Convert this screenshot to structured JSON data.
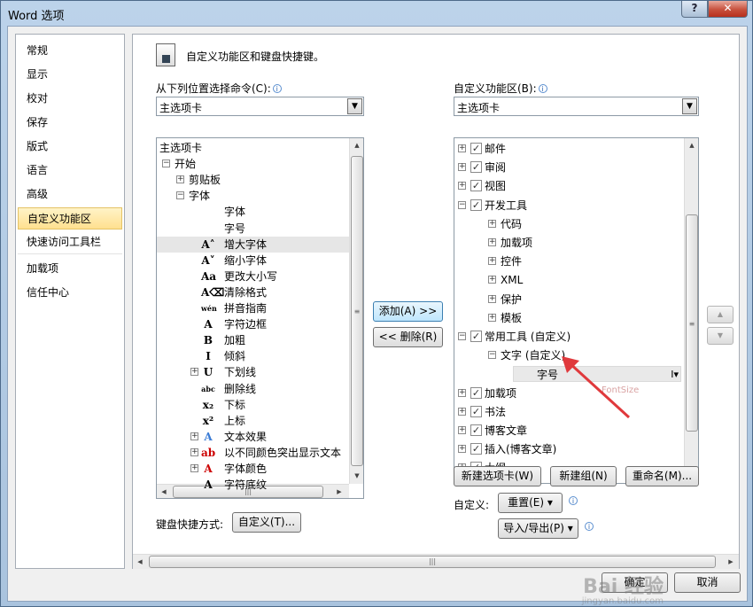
{
  "window": {
    "title": "Word 选项",
    "help_label": "?",
    "close_label": "✕"
  },
  "nav": {
    "items": [
      {
        "label": "常规"
      },
      {
        "label": "显示"
      },
      {
        "label": "校对"
      },
      {
        "label": "保存"
      },
      {
        "label": "版式"
      },
      {
        "label": "语言"
      },
      {
        "label": "高级"
      },
      {
        "label": "自定义功能区"
      },
      {
        "label": "快速访问工具栏"
      },
      {
        "label": "加载项"
      },
      {
        "label": "信任中心"
      }
    ],
    "selected": "自定义功能区"
  },
  "header": {
    "title": "自定义功能区和键盘快捷键。"
  },
  "left": {
    "label": "从下列位置选择命令(C):",
    "combo_value": "主选项卡",
    "tree": [
      {
        "label": "主选项卡"
      },
      {
        "label": "开始",
        "exp": "−"
      },
      {
        "label": "剪贴板",
        "exp": "+"
      },
      {
        "label": "字体",
        "exp": "−"
      },
      {
        "label": "字体"
      },
      {
        "label": "字号"
      },
      {
        "label": "增大字体",
        "icon": "A˄"
      },
      {
        "label": "缩小字体",
        "icon": "A˅"
      },
      {
        "label": "更改大小写",
        "icon": "Aa"
      },
      {
        "label": "清除格式",
        "icon": "A⌫"
      },
      {
        "label": "拼音指南",
        "icon": "wén"
      },
      {
        "label": "字符边框",
        "icon": "A"
      },
      {
        "label": "加粗",
        "icon": "B"
      },
      {
        "label": "倾斜",
        "icon": "I"
      },
      {
        "label": "下划线",
        "icon": "U",
        "exp": "+"
      },
      {
        "label": "删除线",
        "icon": "abc"
      },
      {
        "label": "下标",
        "icon": "x₂"
      },
      {
        "label": "上标",
        "icon": "x²"
      },
      {
        "label": "文本效果",
        "icon": "A",
        "exp": "+"
      },
      {
        "label": "以不同颜色突出显示文本",
        "icon": "ab",
        "exp": "+"
      },
      {
        "label": "字体颜色",
        "icon": "A",
        "exp": "+"
      },
      {
        "label": "字符底纹",
        "icon": "A"
      }
    ],
    "shortcut_label": "键盘快捷方式:",
    "shortcut_button": "自定义(T)..."
  },
  "middle": {
    "add_button": "添加(A) >>",
    "remove_button": "<< 删除(R)"
  },
  "right": {
    "label": "自定义功能区(B):",
    "combo_value": "主选项卡",
    "tree": [
      {
        "label": "邮件",
        "exp": "+",
        "checked": true
      },
      {
        "label": "审阅",
        "exp": "+",
        "checked": true
      },
      {
        "label": "视图",
        "exp": "+",
        "checked": true
      },
      {
        "label": "开发工具",
        "exp": "−",
        "checked": true
      },
      {
        "label": "代码",
        "exp": "+"
      },
      {
        "label": "加载项",
        "exp": "+"
      },
      {
        "label": "控件",
        "exp": "+"
      },
      {
        "label": "XML",
        "exp": "+"
      },
      {
        "label": "保护",
        "exp": "+"
      },
      {
        "label": "模板",
        "exp": "+"
      },
      {
        "label": "常用工具 (自定义)",
        "exp": "−",
        "checked": true
      },
      {
        "label": "文字 (自定义)",
        "exp": "−"
      },
      {
        "label": "字号"
      },
      {
        "label": "加载项",
        "exp": "+",
        "checked": true
      },
      {
        "label": "书法",
        "exp": "+",
        "checked": true
      },
      {
        "label": "博客文章",
        "exp": "+",
        "checked": true
      },
      {
        "label": "插入(博客文章)",
        "exp": "+",
        "checked": true
      },
      {
        "label": "大纲",
        "exp": "+",
        "checked": true
      }
    ],
    "ghost_text": "FontSize",
    "new_tab_button": "新建选项卡(W)",
    "new_group_button": "新建组(N)",
    "rename_button": "重命名(M)...",
    "customize_label": "自定义:",
    "reset_button": "重置(E) ▾",
    "import_export_button": "导入/导出(P) ▾"
  },
  "footer": {
    "ok_button": "确定",
    "cancel_button": "取消"
  },
  "watermark": {
    "text": "Bai 经验",
    "sub": "jingyan.baidu.com"
  }
}
